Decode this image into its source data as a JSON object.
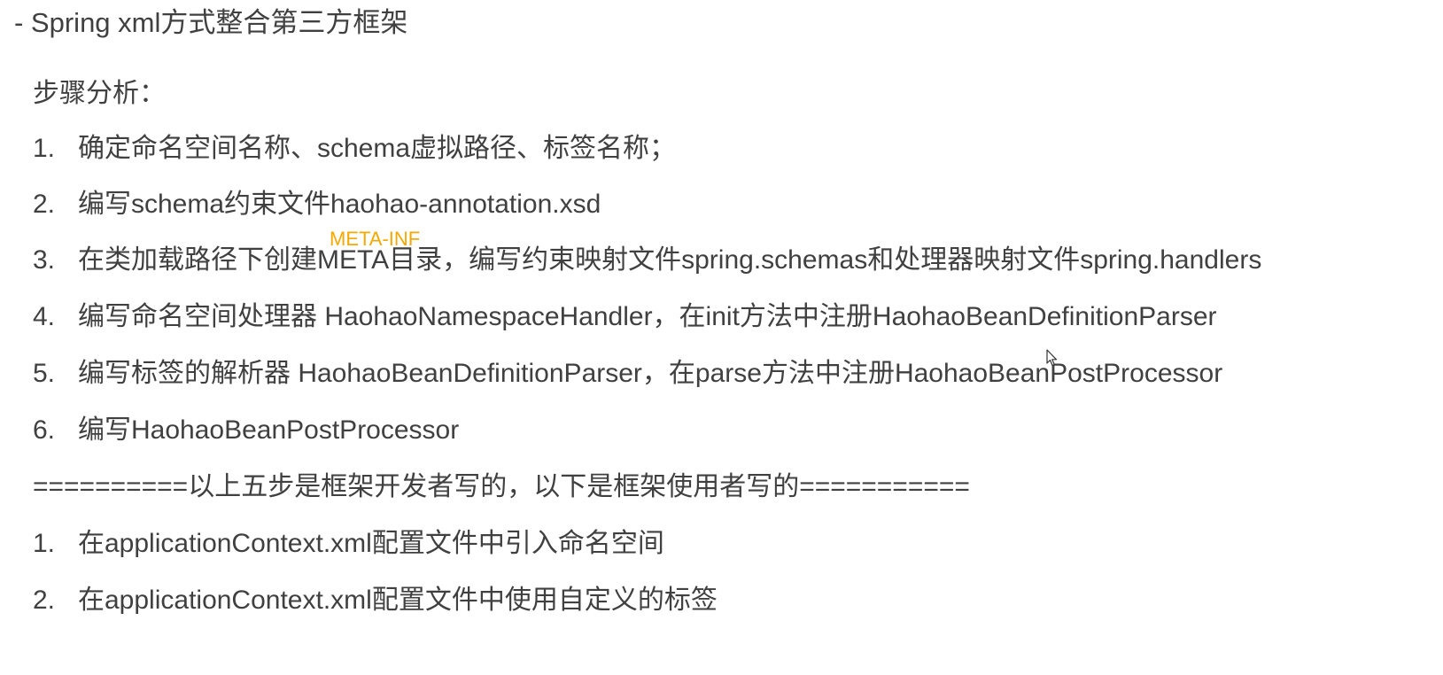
{
  "title": "- Spring xml方式整合第三方框架",
  "analysis_label": "步骤分析：",
  "developer_steps": [
    {
      "num": "1.",
      "text": "确定命名空间名称、schema虚拟路径、标签名称；"
    },
    {
      "num": "2.",
      "text": "编写schema约束文件haohao-annotation.xsd"
    },
    {
      "num": "3.",
      "text": "在类加载路径下创建META目录，编写约束映射文件spring.schemas和处理器映射文件spring.handlers"
    },
    {
      "num": "4.",
      "text": "编写命名空间处理器 HaohaoNamespaceHandler，在init方法中注册HaohaoBeanDefinitionParser"
    },
    {
      "num": "5.",
      "text": "编写标签的解析器 HaohaoBeanDefinitionParser，在parse方法中注册HaohaoBeanPostProcessor"
    },
    {
      "num": "6.",
      "text": "编写HaohaoBeanPostProcessor"
    }
  ],
  "annotation": "META-INF",
  "separator": "==========以上五步是框架开发者写的，以下是框架使用者写的===========",
  "user_steps": [
    {
      "num": "1.",
      "text": "在applicationContext.xml配置文件中引入命名空间"
    },
    {
      "num": "2.",
      "text": "在applicationContext.xml配置文件中使用自定义的标签"
    }
  ],
  "icons": {
    "cursor": "mouse-pointer-icon"
  },
  "colors": {
    "text": "#404040",
    "annotation": "#f5a800"
  }
}
